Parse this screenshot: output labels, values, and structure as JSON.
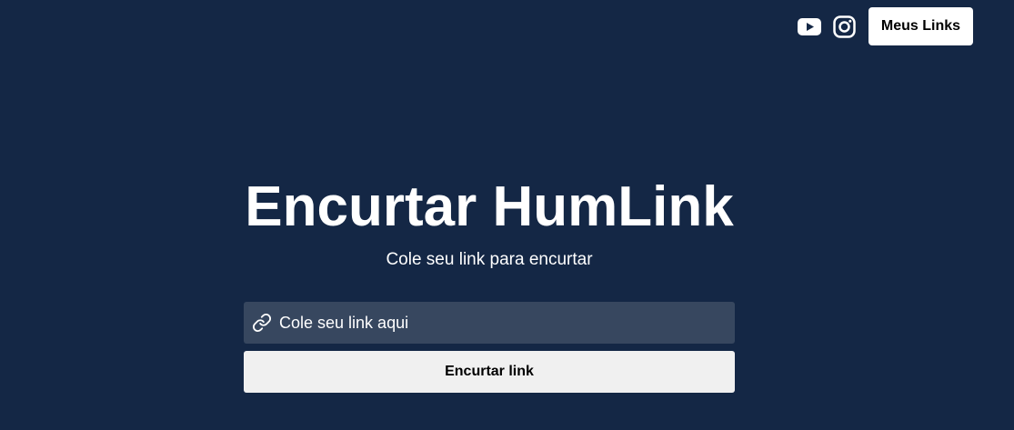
{
  "header": {
    "social_icons": [
      {
        "icon": "youtube-icon"
      },
      {
        "icon": "instagram-icon"
      }
    ],
    "meus_links_label": "Meus Links"
  },
  "hero": {
    "title": "Encurtar HumLink",
    "subtitle": "Cole seu link para encurtar"
  },
  "form": {
    "input_icon": "link-icon",
    "input_placeholder": "Cole seu link aqui",
    "input_value": "",
    "submit_label": "Encurtar link"
  },
  "colors": {
    "background": "#142745",
    "input_background": "#37475f",
    "button_background": "#f0f0f0",
    "header_button_background": "#ffffff",
    "text": "#ffffff"
  }
}
